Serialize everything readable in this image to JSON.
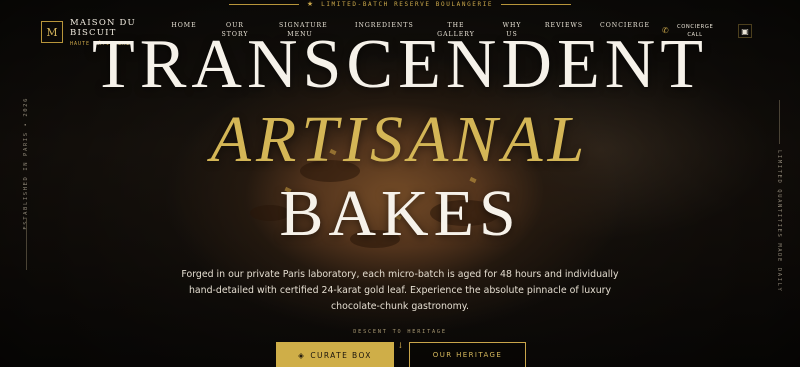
{
  "banner": {
    "text": "LIMITED-BATCH RESERVE BOULANGERIE",
    "icon": "star-icon"
  },
  "logo": {
    "mark": "M",
    "name": "MAISON DU BISCUIT",
    "subtitle": "HAUTE PÂTISSERIE"
  },
  "nav": {
    "items": [
      {
        "label": "HOME"
      },
      {
        "label": "OUR STORY"
      },
      {
        "label": "SIGNATURE MENU"
      },
      {
        "label": "INGREDIENTS"
      },
      {
        "label": "THE GALLERY"
      },
      {
        "label": "WHY US"
      },
      {
        "label": "REVIEWS"
      },
      {
        "label": "CONCIERGE"
      }
    ],
    "call_label": "CONCIERGE CALL",
    "call_icon": "phone-icon",
    "cart_icon": "shopping-bag-icon"
  },
  "side": {
    "left_text": "ESTABLISHED IN PARIS • 2026",
    "right_text": "LIMITED QUANTITIES MADE DAILY"
  },
  "hero": {
    "line1": "TRANSCENDENT",
    "line2": "ARTISANAL",
    "line3": "BAKES",
    "description": "Forged in our private Paris laboratory, each micro-batch is aged for 48 hours and individually hand-detailed with certified 24-karat gold leaf. Experience the absolute pinnacle of luxury chocolate-chunk gastronomy."
  },
  "scroll": {
    "label": "DESCENT TO HERITAGE",
    "icon": "arrow-down-icon"
  },
  "cta": {
    "primary_label": "CURATE BOX",
    "primary_icon": "box-icon",
    "secondary_label": "OUR HERITAGE"
  },
  "colors": {
    "gold": "#cfae48",
    "background": "#0d0b08",
    "text": "#f6f2ea"
  }
}
